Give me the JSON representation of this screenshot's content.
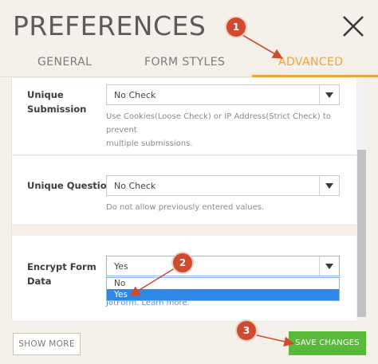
{
  "header": {
    "title": "PREFERENCES",
    "close_icon": "close-icon"
  },
  "tabs": [
    {
      "label": "GENERAL",
      "active": false
    },
    {
      "label": "FORM STYLES",
      "active": false
    },
    {
      "label": "ADVANCED",
      "active": true
    }
  ],
  "settings": {
    "unique_submission": {
      "label_line1": "Unique",
      "label_line2": "Submission",
      "value": "No Check",
      "help_line1": "Use Cookies(Loose Check) or IP Address(Strict Check) to prevent",
      "help_line2": "multiple submissions."
    },
    "unique_question": {
      "label": "Unique Question",
      "value": "No Check",
      "help": "Do not allow previously entered values."
    },
    "encrypt_form_data": {
      "label_line1": "Encrypt Form",
      "label_line2": "Data",
      "value": "Yes",
      "options": [
        "No",
        "Yes"
      ],
      "highlighted_option": "Yes",
      "help_partial": "JotForm. Learn more."
    }
  },
  "footer": {
    "show_more_label": "SHOW MORE",
    "save_label": "SAVE CHANGES"
  },
  "annotations": {
    "badge1": "1",
    "badge2": "2",
    "badge3": "3"
  },
  "colors": {
    "accent": "#f0a23b",
    "save_button": "#58b93b",
    "dropdown_highlight": "#2c87e6",
    "annotation_red": "#cf4b2f"
  }
}
